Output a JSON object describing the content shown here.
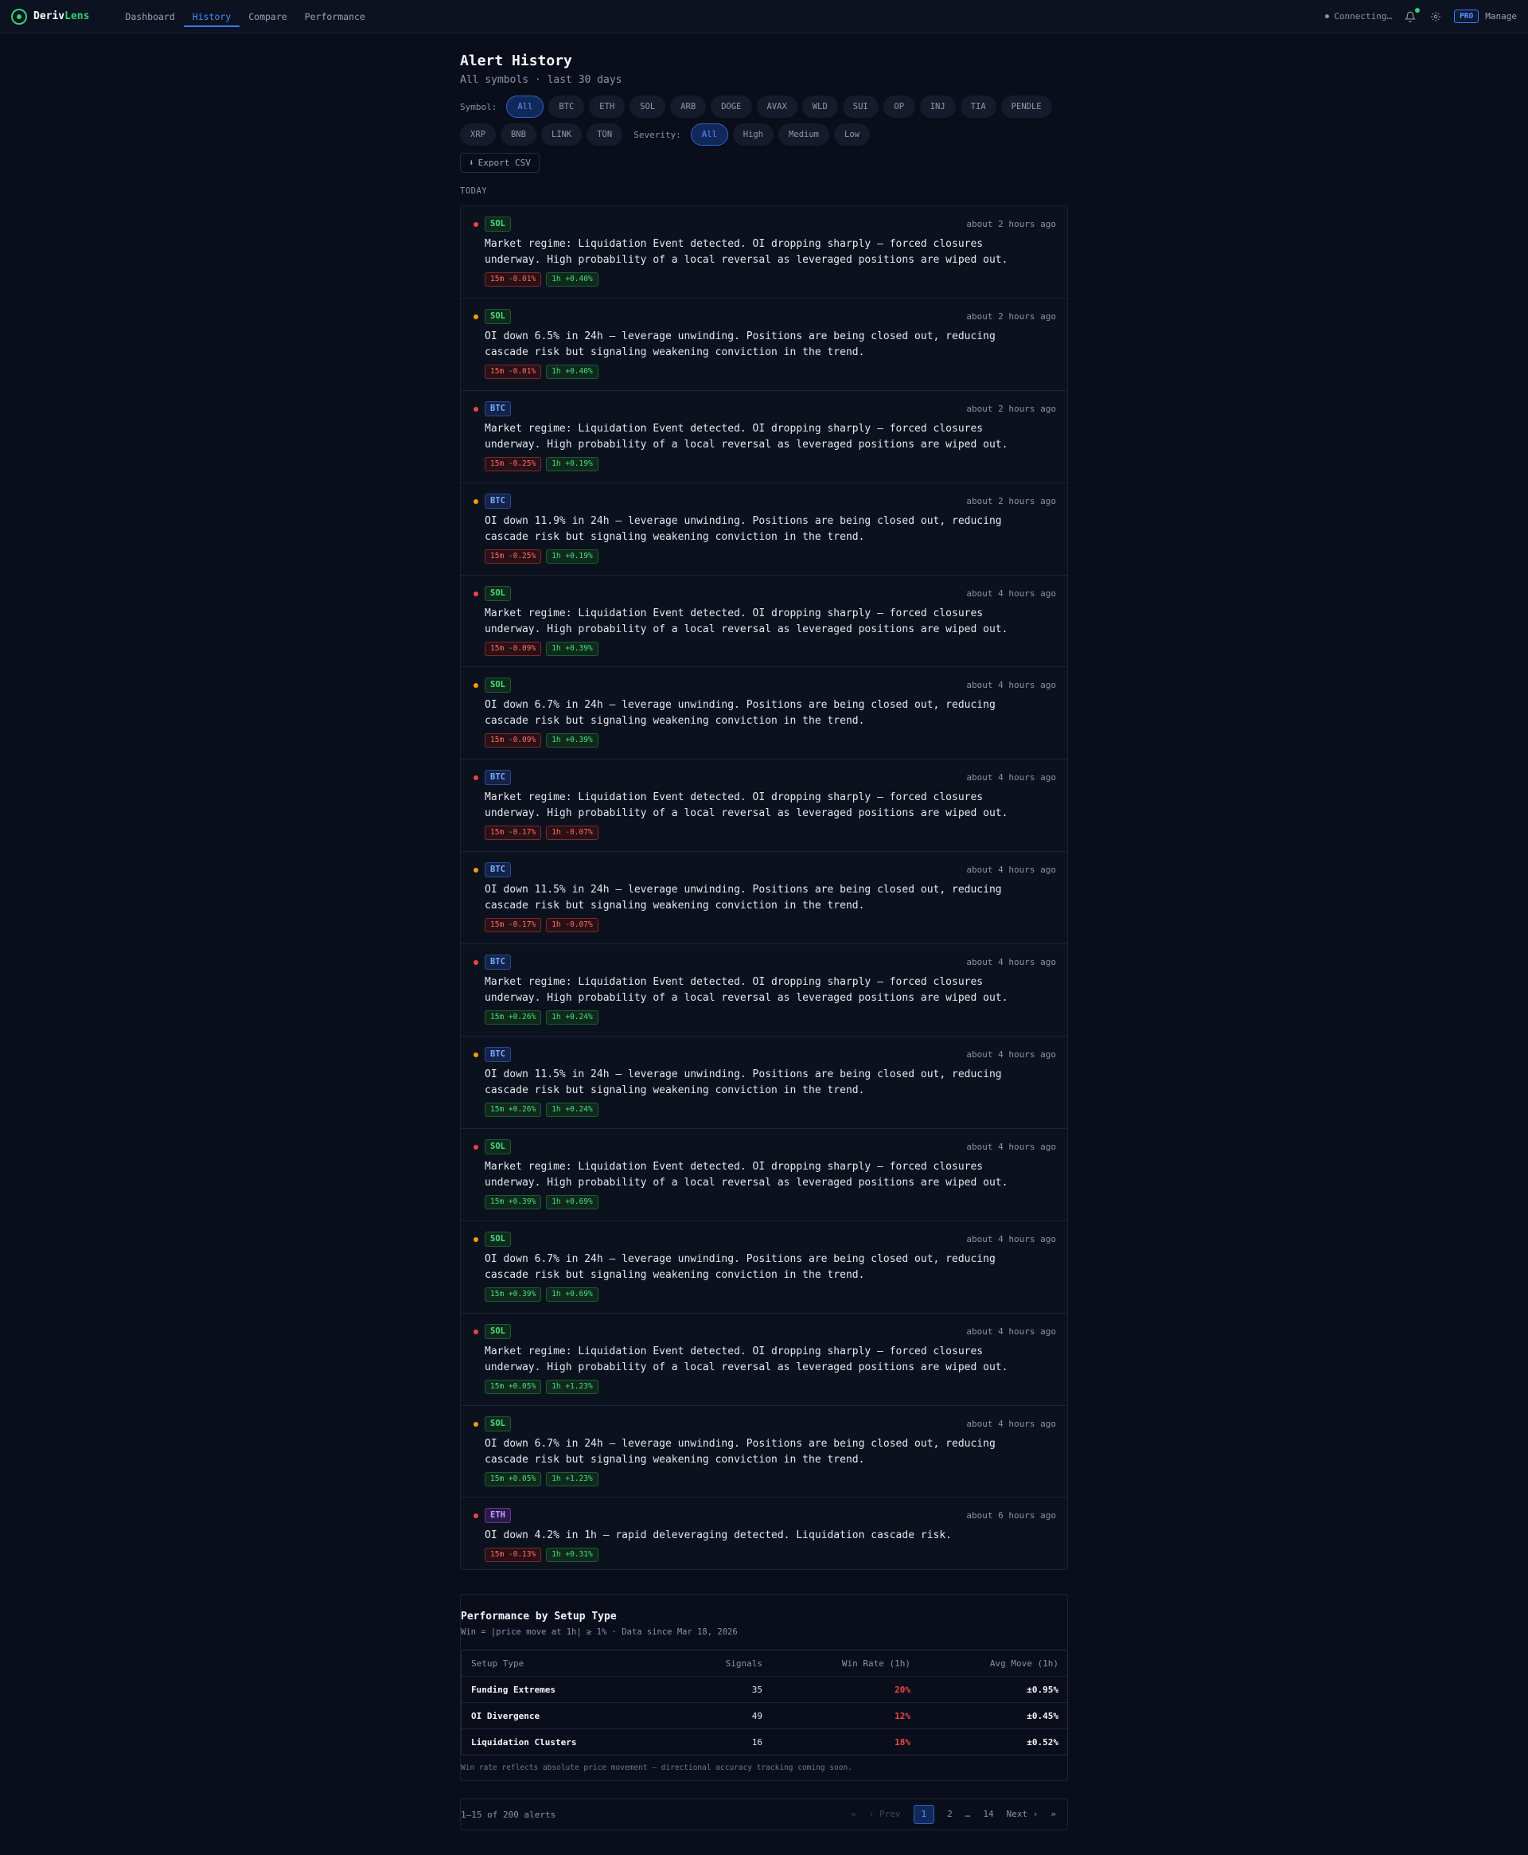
{
  "nav": {
    "brand_a": "Deriv",
    "brand_b": "Lens",
    "links": [
      "Dashboard",
      "History",
      "Compare",
      "Performance"
    ],
    "active": "History",
    "status": "Connecting…",
    "plan": "PRO",
    "manage": "Manage"
  },
  "page": {
    "title": "Alert History",
    "subtitle": "All symbols · last 30 days"
  },
  "filters": {
    "symbol_label": "Symbol:",
    "symbols": [
      "All",
      "BTC",
      "ETH",
      "SOL",
      "ARB",
      "DOGE",
      "AVAX",
      "WLD",
      "SUI",
      "OP",
      "INJ",
      "TIA",
      "PENDLE",
      "XRP",
      "BNB",
      "LINK",
      "TON"
    ],
    "severity_label": "Severity:",
    "severities": [
      "All",
      "High",
      "Medium",
      "Low"
    ],
    "export": "Export CSV"
  },
  "section": "TODAY",
  "alerts": [
    {
      "sym": "SOL",
      "sev": "high",
      "time": "about 2 hours ago",
      "msg": "Market regime: Liquidation Event detected. OI dropping sharply — forced closures underway. High probability of a local reversal as leveraged positions are wiped out.",
      "m15": "15m -0.01%",
      "m1h": "1h +0.40%"
    },
    {
      "sym": "SOL",
      "sev": "medium",
      "time": "about 2 hours ago",
      "msg": "OI down 6.5% in 24h — leverage unwinding. Positions are being closed out, reducing cascade risk but signaling weakening conviction in the trend.",
      "m15": "15m -0.01%",
      "m1h": "1h +0.40%"
    },
    {
      "sym": "BTC",
      "sev": "high",
      "time": "about 2 hours ago",
      "msg": "Market regime: Liquidation Event detected. OI dropping sharply — forced closures underway. High probability of a local reversal as leveraged positions are wiped out.",
      "m15": "15m -0.25%",
      "m1h": "1h +0.19%"
    },
    {
      "sym": "BTC",
      "sev": "medium",
      "time": "about 2 hours ago",
      "msg": "OI down 11.9% in 24h — leverage unwinding. Positions are being closed out, reducing cascade risk but signaling weakening conviction in the trend.",
      "m15": "15m -0.25%",
      "m1h": "1h +0.19%"
    },
    {
      "sym": "SOL",
      "sev": "high",
      "time": "about 4 hours ago",
      "msg": "Market regime: Liquidation Event detected. OI dropping sharply — forced closures underway. High probability of a local reversal as leveraged positions are wiped out.",
      "m15": "15m -0.09%",
      "m1h": "1h +0.39%"
    },
    {
      "sym": "SOL",
      "sev": "medium",
      "time": "about 4 hours ago",
      "msg": "OI down 6.7% in 24h — leverage unwinding. Positions are being closed out, reducing cascade risk but signaling weakening conviction in the trend.",
      "m15": "15m -0.09%",
      "m1h": "1h +0.39%"
    },
    {
      "sym": "BTC",
      "sev": "high",
      "time": "about 4 hours ago",
      "msg": "Market regime: Liquidation Event detected. OI dropping sharply — forced closures underway. High probability of a local reversal as leveraged positions are wiped out.",
      "m15": "15m -0.17%",
      "m1h": "1h -0.07%"
    },
    {
      "sym": "BTC",
      "sev": "medium",
      "time": "about 4 hours ago",
      "msg": "OI down 11.5% in 24h — leverage unwinding. Positions are being closed out, reducing cascade risk but signaling weakening conviction in the trend.",
      "m15": "15m -0.17%",
      "m1h": "1h -0.07%"
    },
    {
      "sym": "BTC",
      "sev": "high",
      "time": "about 4 hours ago",
      "msg": "Market regime: Liquidation Event detected. OI dropping sharply — forced closures underway. High probability of a local reversal as leveraged positions are wiped out.",
      "m15": "15m +0.26%",
      "m1h": "1h +0.24%"
    },
    {
      "sym": "BTC",
      "sev": "medium",
      "time": "about 4 hours ago",
      "msg": "OI down 11.5% in 24h — leverage unwinding. Positions are being closed out, reducing cascade risk but signaling weakening conviction in the trend.",
      "m15": "15m +0.26%",
      "m1h": "1h +0.24%"
    },
    {
      "sym": "SOL",
      "sev": "high",
      "time": "about 4 hours ago",
      "msg": "Market regime: Liquidation Event detected. OI dropping sharply — forced closures underway. High probability of a local reversal as leveraged positions are wiped out.",
      "m15": "15m +0.39%",
      "m1h": "1h +0.69%"
    },
    {
      "sym": "SOL",
      "sev": "medium",
      "time": "about 4 hours ago",
      "msg": "OI down 6.7% in 24h — leverage unwinding. Positions are being closed out, reducing cascade risk but signaling weakening conviction in the trend.",
      "m15": "15m +0.39%",
      "m1h": "1h +0.69%"
    },
    {
      "sym": "SOL",
      "sev": "high",
      "time": "about 4 hours ago",
      "msg": "Market regime: Liquidation Event detected. OI dropping sharply — forced closures underway. High probability of a local reversal as leveraged positions are wiped out.",
      "m15": "15m +0.05%",
      "m1h": "1h +1.23%"
    },
    {
      "sym": "SOL",
      "sev": "medium",
      "time": "about 4 hours ago",
      "msg": "OI down 6.7% in 24h — leverage unwinding. Positions are being closed out, reducing cascade risk but signaling weakening conviction in the trend.",
      "m15": "15m +0.05%",
      "m1h": "1h +1.23%"
    },
    {
      "sym": "ETH",
      "sev": "high",
      "time": "about 6 hours ago",
      "msg": "OI down 4.2% in 1h — rapid deleveraging detected. Liquidation cascade risk.",
      "m15": "15m -0.13%",
      "m1h": "1h +0.31%"
    }
  ],
  "performance": {
    "title": "Performance by Setup Type",
    "subtitle": "Win = |price move at 1h| ≥ 1% · Data since Mar 18, 2026",
    "columns": [
      "Setup Type",
      "Signals",
      "Win Rate (1h)",
      "Avg Move (1h)"
    ],
    "rows": [
      {
        "name": "Funding Extremes",
        "signals": "35",
        "win": "20%",
        "avg": "±0.95%"
      },
      {
        "name": "OI Divergence",
        "signals": "49",
        "win": "12%",
        "avg": "±0.45%"
      },
      {
        "name": "Liquidation Clusters",
        "signals": "16",
        "win": "18%",
        "avg": "±0.52%"
      }
    ],
    "note": "Win rate reflects absolute price movement — directional accuracy tracking coming soon."
  },
  "pagination": {
    "info": "1–15 of 200 alerts",
    "first": "«",
    "prev": "‹ Prev",
    "pages": [
      "1",
      "2",
      "…",
      "14"
    ],
    "current": "1",
    "next": "Next ›",
    "last": "»"
  }
}
